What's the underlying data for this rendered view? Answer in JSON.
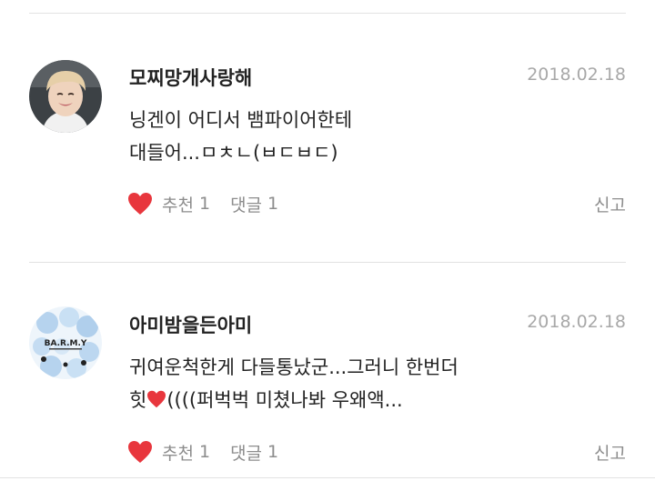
{
  "comments": [
    {
      "username": "모찌망개사랑해",
      "date": "2018.02.18",
      "line1": "닝겐이 어디서 뱀파이어한테",
      "line2": "대들어...ㅁㅊㄴ(ㅂㄷㅂㄷ)",
      "like_label": "추천",
      "like_count": "1",
      "reply_label": "댓글",
      "reply_count": "1",
      "report_label": "신고",
      "avatar_icon": "user-photo-avatar"
    },
    {
      "username": "아미밤을든아미",
      "date": "2018.02.18",
      "line1": "귀여운척한게 다들통났군...그러니 한번더",
      "line2_before": "힛",
      "line2_after": "((((퍼벅벅 미쳤나봐 우왜액...",
      "like_label": "추천",
      "like_count": "1",
      "reply_label": "댓글",
      "reply_count": "1",
      "report_label": "신고",
      "avatar_icon": "army-bomb-avatar",
      "avatar_text": "BA.R.M.Y"
    }
  ],
  "colors": {
    "heart": "#e8363d",
    "date": "#a8a8a8",
    "meta": "#8d8d8d",
    "divider": "#e2e2e2"
  }
}
